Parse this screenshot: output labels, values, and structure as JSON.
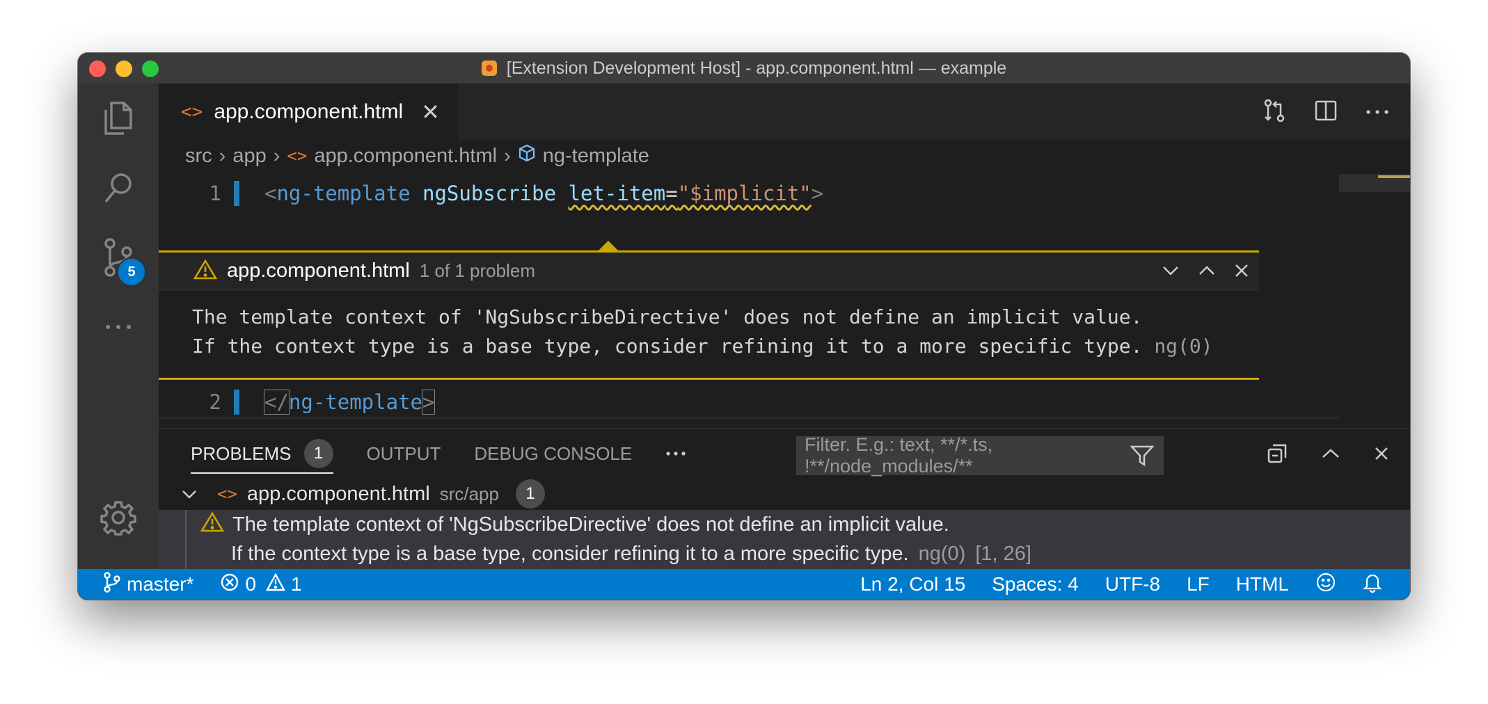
{
  "window": {
    "title": "[Extension Development Host] - app.component.html — example"
  },
  "activity_bar": {
    "scm_badge": "5"
  },
  "tab": {
    "label": "app.component.html"
  },
  "breadcrumb": [
    "src",
    "app",
    "app.component.html",
    "ng-template"
  ],
  "editor": {
    "lines": [
      {
        "num": "1",
        "tokens": {
          "open": "<",
          "tag": "ng-template",
          "attr1": "ngSubscribe",
          "attr2": "let-item",
          "eq": "=",
          "value": "\"$implicit\"",
          "close": ">"
        }
      },
      {
        "num": "2",
        "tokens": {
          "open": "</",
          "tag": "ng-template",
          "close": ">"
        }
      }
    ]
  },
  "peek": {
    "file": "app.component.html",
    "count": "1 of 1 problem",
    "message_line1": "The template context of 'NgSubscribeDirective' does not define an implicit value.",
    "message_line2": "If the context type is a base type, consider refining it to a more specific type.",
    "code": "ng(0)"
  },
  "panel": {
    "tabs": {
      "problems": "PROBLEMS",
      "problems_count": "1",
      "output": "OUTPUT",
      "debug": "DEBUG CONSOLE"
    },
    "filter_placeholder": "Filter. E.g.: text, **/*.ts, !**/node_modules/**",
    "file": {
      "name": "app.component.html",
      "path": "src/app",
      "count": "1"
    },
    "problem": {
      "line1": "The template context of 'NgSubscribeDirective' does not define an implicit value.",
      "line2": "If the context type is a base type, consider refining it to a more specific type.",
      "code": "ng(0)",
      "position": "[1, 26]"
    }
  },
  "statusbar": {
    "branch": "master*",
    "errors": "0",
    "warnings": "1",
    "cursor": "Ln 2, Col 15",
    "spaces": "Spaces: 4",
    "encoding": "UTF-8",
    "eol": "LF",
    "language": "HTML"
  },
  "colors": {
    "statusbar": "#007acc",
    "warning": "#cca700",
    "editor_bg": "#1e1e1e",
    "file_icon": "#e37933"
  }
}
